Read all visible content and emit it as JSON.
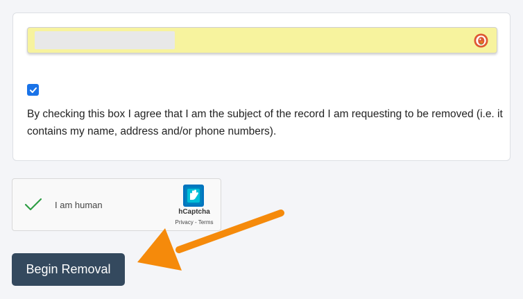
{
  "form": {
    "email_value": "",
    "agree_checked": true,
    "agree_text": "By checking this box I agree that I am the subject of the record I am requesting to be removed (i.e. it contains my name, address and/or phone numbers)."
  },
  "captcha": {
    "label": "I am human",
    "brand": "hCaptcha",
    "links": "Privacy - Terms"
  },
  "actions": {
    "begin_label": "Begin Removal"
  },
  "colors": {
    "autofill_bg": "#f7f39e",
    "checkbox": "#1a73e8",
    "button": "#34495e",
    "arrow": "#f58a0b",
    "captcha_check": "#2e9d44"
  },
  "icons": {
    "field_icon": "duckduckgo-icon",
    "captcha_logo": "hcaptcha-logo-icon"
  }
}
